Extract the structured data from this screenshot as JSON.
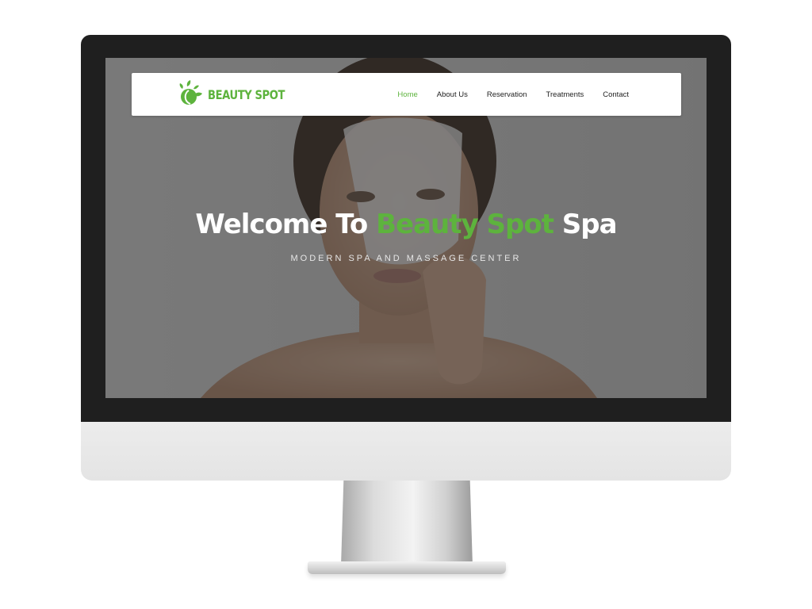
{
  "colors": {
    "accent": "#5db33d",
    "bezel": "#1f1f1f",
    "chin": "#e8e8e8",
    "nav_text": "#222222",
    "hero_text": "#ffffff"
  },
  "logo": {
    "icon": "leaf-face-logo-icon",
    "text": "BEAUTY SPOT"
  },
  "nav": {
    "items": [
      {
        "label": "Home",
        "active": true
      },
      {
        "label": "About Us",
        "active": false
      },
      {
        "label": "Reservation",
        "active": false
      },
      {
        "label": "Treatments",
        "active": false
      },
      {
        "label": "Contact",
        "active": false
      }
    ]
  },
  "hero": {
    "title_part1": "Welcome To",
    "title_highlight": "Beauty Spot",
    "title_part2": "Spa",
    "subtitle": "MODERN SPA AND MASSAGE CENTER",
    "image": "woman-peeling-face-mask-photo"
  }
}
